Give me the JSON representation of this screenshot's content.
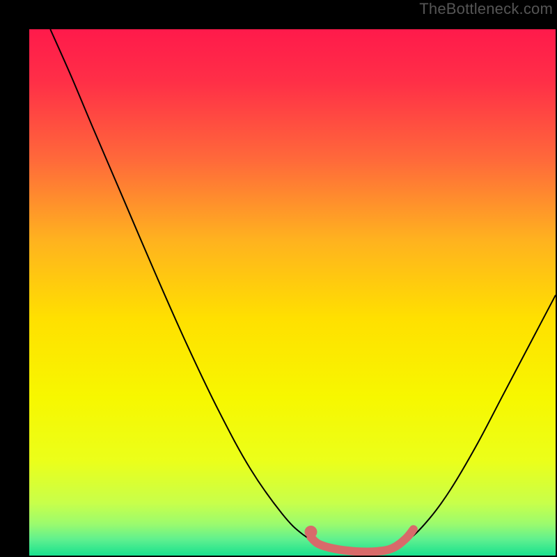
{
  "watermark": "TheBottleneck.com",
  "chart_data": {
    "type": "line",
    "title": "",
    "xlabel": "",
    "ylabel": "",
    "xlim": [
      0,
      100
    ],
    "ylim": [
      0,
      100
    ],
    "gradient_stops": [
      {
        "offset": 0.0,
        "color": "#ff1a4b"
      },
      {
        "offset": 0.1,
        "color": "#ff2f47"
      },
      {
        "offset": 0.25,
        "color": "#ff6a3a"
      },
      {
        "offset": 0.4,
        "color": "#ffb21f"
      },
      {
        "offset": 0.55,
        "color": "#ffe000"
      },
      {
        "offset": 0.7,
        "color": "#f7f700"
      },
      {
        "offset": 0.82,
        "color": "#ebff1a"
      },
      {
        "offset": 0.9,
        "color": "#c8ff4a"
      },
      {
        "offset": 0.94,
        "color": "#9bfb6e"
      },
      {
        "offset": 0.97,
        "color": "#5ef08f"
      },
      {
        "offset": 1.0,
        "color": "#17e18e"
      }
    ],
    "series": [
      {
        "name": "bottleneck-curve",
        "stroke": "#000000",
        "stroke_width": 2,
        "points": [
          {
            "x": 4.0,
            "y": 100.0
          },
          {
            "x": 8.0,
            "y": 91.0
          },
          {
            "x": 12.0,
            "y": 81.5
          },
          {
            "x": 18.0,
            "y": 67.5
          },
          {
            "x": 24.0,
            "y": 53.5
          },
          {
            "x": 30.0,
            "y": 40.0
          },
          {
            "x": 36.0,
            "y": 27.5
          },
          {
            "x": 42.0,
            "y": 16.5
          },
          {
            "x": 48.0,
            "y": 8.0
          },
          {
            "x": 52.0,
            "y": 4.0
          },
          {
            "x": 56.0,
            "y": 1.8
          },
          {
            "x": 60.0,
            "y": 0.8
          },
          {
            "x": 64.0,
            "y": 0.6
          },
          {
            "x": 68.0,
            "y": 1.0
          },
          {
            "x": 72.0,
            "y": 3.0
          },
          {
            "x": 76.0,
            "y": 7.0
          },
          {
            "x": 80.0,
            "y": 12.5
          },
          {
            "x": 85.0,
            "y": 21.0
          },
          {
            "x": 90.0,
            "y": 30.5
          },
          {
            "x": 95.0,
            "y": 40.0
          },
          {
            "x": 100.0,
            "y": 49.5
          }
        ]
      },
      {
        "name": "optimal-range-highlight",
        "stroke": "#d86a6a",
        "stroke_width": 12,
        "linecap": "round",
        "points": [
          {
            "x": 53.5,
            "y": 3.5
          },
          {
            "x": 55.0,
            "y": 2.2
          },
          {
            "x": 58.0,
            "y": 1.3
          },
          {
            "x": 62.0,
            "y": 0.8
          },
          {
            "x": 66.0,
            "y": 0.8
          },
          {
            "x": 69.0,
            "y": 1.4
          },
          {
            "x": 71.5,
            "y": 3.2
          },
          {
            "x": 73.0,
            "y": 5.0
          }
        ]
      }
    ],
    "markers": [
      {
        "name": "optimal-point",
        "x": 53.5,
        "y": 4.5,
        "r": 9,
        "fill": "#d86a6a"
      }
    ]
  }
}
